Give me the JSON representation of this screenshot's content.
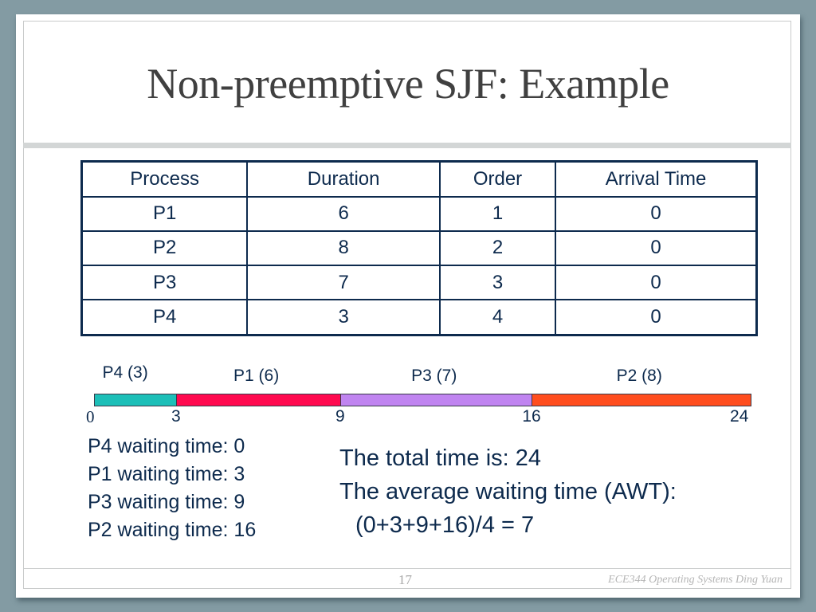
{
  "slide": {
    "title": "Non-preemptive SJF: Example",
    "page_number": "17",
    "footer": "ECE344 Operating Systems Ding Yuan"
  },
  "table": {
    "headers": [
      "Process",
      "Duration",
      "Order",
      "Arrival Time"
    ],
    "rows": [
      [
        "P1",
        "6",
        "1",
        "0"
      ],
      [
        "P2",
        "8",
        "2",
        "0"
      ],
      [
        "P3",
        "7",
        "3",
        "0"
      ],
      [
        "P4",
        "3",
        "4",
        "0"
      ]
    ]
  },
  "gantt": {
    "total": 24,
    "segments": [
      {
        "label": "P4 (3)",
        "start": 0,
        "end": 3,
        "color": "#1dbfb8"
      },
      {
        "label": "P1 (6)",
        "start": 3,
        "end": 9,
        "color": "#ff0a4f"
      },
      {
        "label": "P3 (7)",
        "start": 9,
        "end": 16,
        "color": "#c084f0"
      },
      {
        "label": "P2 (8)",
        "start": 16,
        "end": 24,
        "color": "#ff4d1e"
      }
    ],
    "ticks": [
      "0",
      "3",
      "9",
      "16",
      "24"
    ]
  },
  "waiting": [
    "P4 waiting time: 0",
    "P1 waiting time: 3",
    "P3 waiting time: 9",
    "P2 waiting time: 16"
  ],
  "summary": {
    "total": "The total time is: 24",
    "awt_label": "The average waiting time (AWT):",
    "awt_formula": "(0+3+9+16)/4 = 7"
  }
}
